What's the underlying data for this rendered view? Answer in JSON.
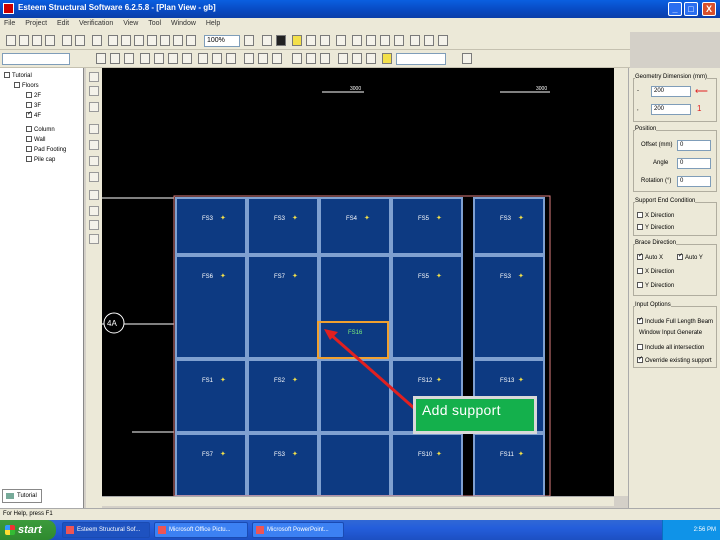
{
  "window": {
    "title": "Esteem Structural Software 6.2.5.8 - [Plan View - gb]",
    "controls": [
      "_",
      "□",
      "X"
    ]
  },
  "menu": [
    "File",
    "Project",
    "Edit",
    "Verification",
    "View",
    "Tool",
    "Window",
    "Help"
  ],
  "toolbar": {
    "zoom_value": "100%",
    "layer_combo": ""
  },
  "tree": {
    "root": "Tutorial",
    "items": [
      {
        "label": "Floors",
        "checked": false,
        "level": 1
      },
      {
        "label": "2F",
        "checked": false,
        "level": 2
      },
      {
        "label": "3F",
        "checked": false,
        "level": 2
      },
      {
        "label": "4F",
        "checked": true,
        "level": 2
      },
      {
        "label": "Column",
        "checked": false,
        "level": 1
      },
      {
        "label": "Wall",
        "checked": false,
        "level": 1
      },
      {
        "label": "Pad Footing",
        "checked": false,
        "level": 1
      },
      {
        "label": "Pile cap",
        "checked": false,
        "level": 1
      }
    ],
    "tab_label": "Tutorial"
  },
  "canvas": {
    "grid_label": "4A",
    "dim_labels": [
      "3000",
      "3000"
    ],
    "panels": [
      {
        "id": "FS3"
      },
      {
        "id": "FS3"
      },
      {
        "id": "FS4"
      },
      {
        "id": "FS5"
      },
      {
        "id": "FS3"
      },
      {
        "id": "FS6"
      },
      {
        "id": "FS7"
      },
      {
        "id": "FS5"
      },
      {
        "id": "FS3"
      },
      {
        "id": "FS1"
      },
      {
        "id": "FS2"
      },
      {
        "id": "FS12"
      },
      {
        "id": "FS13"
      },
      {
        "id": "FS7"
      },
      {
        "id": "FS3"
      },
      {
        "id": "FS10"
      },
      {
        "id": "FS11"
      }
    ],
    "selected_label": "FS16"
  },
  "callout": {
    "text": "Add support",
    "color": "#14b04c"
  },
  "rightpanel": {
    "dimension_title": "Geometry Dimension (mm)",
    "dim_x_value": "200",
    "dim_y_value": "200",
    "position_title": "Position",
    "offset_label": "Offset (mm)",
    "offset_value": "0",
    "angle_label": "Angle",
    "angle_value": "0",
    "rotation_label": "Rotation (°)",
    "rotation_value": "0",
    "end_condition_title": "Support End Condition",
    "end_conditions": [
      {
        "label": "X Direction",
        "checked": false
      },
      {
        "label": "Y Direction",
        "checked": false
      }
    ],
    "direction_title": "Brace Direction",
    "directions": [
      {
        "label": "Auto X",
        "checked": true
      },
      {
        "label": "Auto Y",
        "checked": true
      },
      {
        "label": "X Direction",
        "checked": false
      },
      {
        "label": "Y Direction",
        "checked": false
      }
    ],
    "input_options_title": "Input Options",
    "input_options": [
      {
        "label": "Include Full Length Beam",
        "checked": true
      }
    ],
    "window_input_title": "Window Input Generate",
    "window_options": [
      {
        "label": "Include all intersection",
        "checked": false
      },
      {
        "label": "Override existing support",
        "checked": true
      }
    ]
  },
  "status": {
    "text": "For Help, press F1"
  },
  "taskbar": {
    "start_label": "start",
    "tasks": [
      "Esteem Structural Sof...",
      "Microsoft Office Pictu...",
      "Microsoft PowerPoint..."
    ],
    "clock": "2:56 PM"
  },
  "colors": {
    "panel_fill": "#0d3a82",
    "panel_border": "#7fa0d0",
    "beam": "#d0d0d0",
    "highlight": "#f0a030",
    "arrow": "#e02020"
  }
}
